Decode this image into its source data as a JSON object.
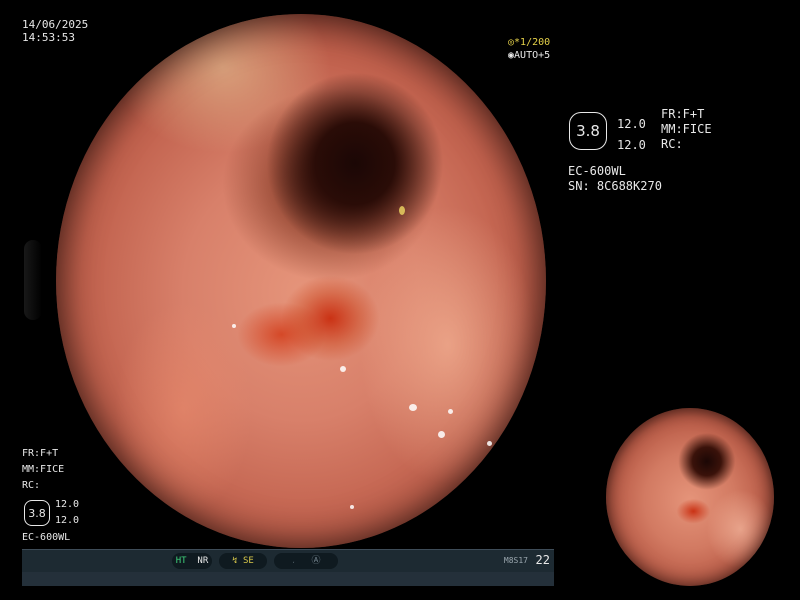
{
  "datetime": {
    "date": "14/06/2025",
    "time": "14:53:53"
  },
  "shutter": {
    "speed": "*1/200",
    "iris": "AUTO+5"
  },
  "right_panel": {
    "structure_enhancement": "3.8",
    "enhance_top": "12.0",
    "enhance_bottom": "12.0",
    "fr": "FR:F+T",
    "mm": "MM:FICE",
    "rc": "RC:",
    "scope_model": "EC-600WL",
    "serial": "SN: 8C688K270"
  },
  "left_panel": {
    "fr": "FR:F+T",
    "mm": "MM:FICE",
    "rc": "RC:",
    "structure_enhancement": "3.8",
    "enhance_top": "12.0",
    "enhance_bottom": "12.0",
    "scope_model": "EC-600WL"
  },
  "status_bar": {
    "ht": "HT",
    "nr": "NR",
    "se": "SE",
    "memory": "M8S17",
    "counter": "22"
  },
  "icons": [
    "shutter-icon",
    "auto-iris-icon",
    "se-icon",
    "flash-icon",
    "record-icon"
  ]
}
